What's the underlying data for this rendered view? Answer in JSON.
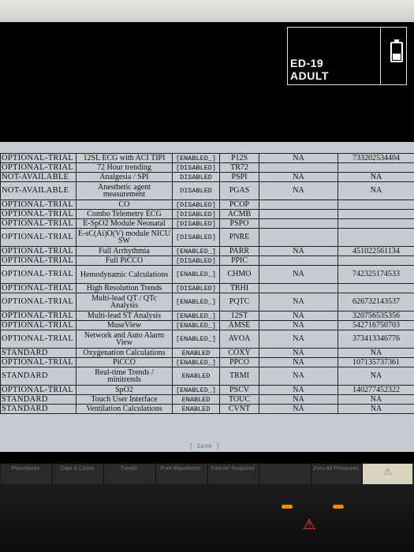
{
  "status": {
    "line1": "ED-19",
    "line2": "ADULT"
  },
  "options": [
    {
      "license": "OPTIONAL-TRIAL",
      "option": "12SL ECG with ACI TIPI",
      "status": "[ENABLED_]",
      "code": "P12S",
      "remaining": "NA",
      "key": "733202534404"
    },
    {
      "license": "OPTIONAL-TRIAL",
      "option": "72 Hour trending",
      "status": "[DISABLED]",
      "code": "TR72",
      "remaining": "",
      "key": ""
    },
    {
      "license": "NOT-AVAILABLE",
      "option": "Analgesia / SPI",
      "status": "DISABLED",
      "code": "PSPI",
      "remaining": "NA",
      "key": "NA"
    },
    {
      "license": "NOT-AVAILABLE",
      "option": "Anesthetic agent measurement",
      "status": "DISABLED",
      "code": "PGAS",
      "remaining": "NA",
      "key": "NA"
    },
    {
      "license": "OPTIONAL-TRIAL",
      "option": "CO",
      "status": "[DISABLED]",
      "code": "PCOP",
      "remaining": "",
      "key": ""
    },
    {
      "license": "OPTIONAL-TRIAL",
      "option": "Combo Telemetry ECG",
      "status": "[DISABLED]",
      "code": "ACMB",
      "remaining": "",
      "key": ""
    },
    {
      "license": "OPTIONAL-TRIAL",
      "option": "E-SpO2 Module Neonatal",
      "status": "[DISABLED]",
      "code": "PSPO",
      "remaining": "",
      "key": ""
    },
    {
      "license": "OPTIONAL-TRIAL",
      "option": "E-sC(Ai)O(V) module NICU SW",
      "status": "[DISABLED]",
      "code": "PNRE",
      "remaining": "",
      "key": ""
    },
    {
      "license": "OPTIONAL-TRIAL",
      "option": "Full Arrhythmia",
      "status": "[ENABLED_]",
      "code": "PARR",
      "remaining": "NA",
      "key": "451022561134"
    },
    {
      "license": "OPTIONAL-TRIAL",
      "option": "Full PiCCO",
      "status": "[DISABLED]",
      "code": "PPIC",
      "remaining": "",
      "key": ""
    },
    {
      "license": "OPTIONAL-TRIAL",
      "option": "Hemodynamic Calculations",
      "status": "[ENABLED_]",
      "code": "CHMO",
      "remaining": "NA",
      "key": "742325174533"
    },
    {
      "license": "OPTIONAL-TRIAL",
      "option": "High Resolution Trends",
      "status": "[DISABLED]",
      "code": "TRHI",
      "remaining": "",
      "key": ""
    },
    {
      "license": "OPTIONAL-TRIAL",
      "option": "Multi-lead QT / QTc Analysis",
      "status": "[ENABLED_]",
      "code": "PQTC",
      "remaining": "NA",
      "key": "626732143537"
    },
    {
      "license": "OPTIONAL-TRIAL",
      "option": "Multi-lead ST Analysis",
      "status": "[ENABLED_]",
      "code": "12ST",
      "remaining": "NA",
      "key": "320756535356"
    },
    {
      "license": "OPTIONAL-TRIAL",
      "option": "MuseView",
      "status": "[ENABLED_]",
      "code": "AMSE",
      "remaining": "NA",
      "key": "542716750703"
    },
    {
      "license": "OPTIONAL-TRIAL",
      "option": "Network and Auto Alarm View",
      "status": "[ENABLED_]",
      "code": "AVOA",
      "remaining": "NA",
      "key": "373413346776"
    },
    {
      "license": "STANDARD",
      "option": "Oxygenation Calculations",
      "status": "ENABLED",
      "code": "COXY",
      "remaining": "NA",
      "key": "NA"
    },
    {
      "license": "OPTIONAL-TRIAL",
      "option": "PiCCO",
      "status": "[ENABLED_]",
      "code": "PPCO",
      "remaining": "NA",
      "key": "107135737361"
    },
    {
      "license": "STANDARD",
      "option": "Real-time Trends / minitrends",
      "status": "ENABLED",
      "code": "TRMI",
      "remaining": "NA",
      "key": "NA"
    },
    {
      "license": "OPTIONAL-TRIAL",
      "option": "SpO2",
      "status": "[ENABLED_]",
      "code": "PSCV",
      "remaining": "NA",
      "key": "140277452322"
    },
    {
      "license": "STANDARD",
      "option": "Touch User Interface",
      "status": "ENABLED",
      "code": "TOUC",
      "remaining": "NA",
      "key": "NA"
    },
    {
      "license": "STANDARD",
      "option": "Ventilation Calculations",
      "status": "ENABLED",
      "code": "CVNT",
      "remaining": "NA",
      "key": "NA"
    }
  ],
  "save_label": "[ Save ]",
  "softkeys": [
    {
      "label": "Procedures"
    },
    {
      "label": "Data & Cases"
    },
    {
      "label": "Trends"
    },
    {
      "label": "Print Waveforms"
    },
    {
      "label": "Freeze/ Snapshot"
    },
    {
      "label": ""
    },
    {
      "label": "Zero All Pressures"
    }
  ],
  "icons": {
    "alert": "warning-triangle-icon",
    "battery": "battery-icon",
    "alarm": "alarm-bell-icon"
  },
  "colors": {
    "table_bg": "#c6ccd1",
    "screen_bg": "#000000",
    "alarm_led": "#ff4a1a"
  }
}
